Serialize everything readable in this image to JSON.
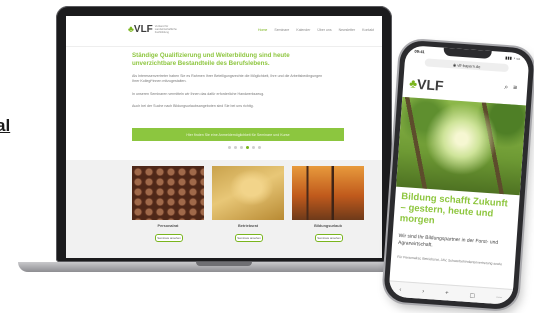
{
  "side_text": "al",
  "site": {
    "logo_text": "VLF",
    "logo_sub": "Verband für Landwirtschaftliche Fachbildung",
    "nav": [
      "Home",
      "Seminare",
      "Kalender",
      "Über uns",
      "Newsletter",
      "Kontakt"
    ],
    "headline": "Ständige Qualifizierung und Weiterbildung sind heute unverzichtbare Bestandteile des Berufslebens.",
    "paragraphs": [
      "Als Interessenvertreter haben Sie es Rahmen Ihrer Beteiligungsrechte die Möglichkeit, Ihre und die Arbeitsbedingungen Ihrer Kollegi*innen mitzugestalten.",
      "In unseren Seminaren vermitteln wir Ihnen das dafür erforderliche Handwerkszeug.",
      "Auch bei der Suche nach Bildungsurlaubsangeboten sind Sie bei uns richtig."
    ],
    "cta": "Hier finden Sie eine Anmeldemöglichkeit für Seminare und Kurse",
    "cards": [
      {
        "title": "Personalrat",
        "button": "Seminare ansehen"
      },
      {
        "title": "Betriebsrat",
        "button": "Seminare ansehen"
      },
      {
        "title": "Bildungsurlaub",
        "button": "Seminare ansehen"
      }
    ]
  },
  "phone": {
    "time": "09:41",
    "status_icons": "▮▮▮ ◔ ▭",
    "url": "◉ vlf-bayern.de",
    "logo_text": "VLF",
    "headline": "Bildung schafft Zukunft – gestern, heute und morgen",
    "subline": "Wir sind Ihr Bildungspartner in der Forst- und Agrarwirtschaft.",
    "small_text": "Für Personalrat, Betriebsrat, JAV, Schwerbehindertenvertretung sowie",
    "bottom_icons": [
      "‹",
      "›",
      "+",
      "▢",
      "⋯"
    ]
  }
}
